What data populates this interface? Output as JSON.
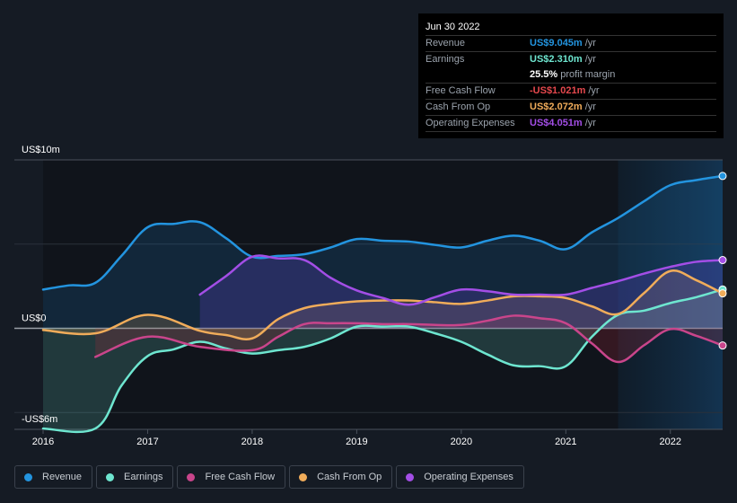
{
  "tooltip": {
    "date": "Jun 30 2022",
    "rows": [
      {
        "label": "Revenue",
        "value": "US$9.045m",
        "unit": "/yr",
        "color": "#2394df"
      },
      {
        "label": "Earnings",
        "value": "US$2.310m",
        "unit": "/yr",
        "color": "#6ee6d0"
      },
      {
        "label": "",
        "value": "25.5%",
        "unit": "profit margin",
        "color": "#ffffff"
      },
      {
        "label": "Free Cash Flow",
        "value": "-US$1.021m",
        "unit": "/yr",
        "color": "#e5484d"
      },
      {
        "label": "Cash From Op",
        "value": "US$2.072m",
        "unit": "/yr",
        "color": "#f0ac5a"
      },
      {
        "label": "Operating Expenses",
        "value": "US$4.051m",
        "unit": "/yr",
        "color": "#a34ee6"
      }
    ]
  },
  "legend": [
    {
      "label": "Revenue",
      "color": "#2394df"
    },
    {
      "label": "Earnings",
      "color": "#6ee6d0"
    },
    {
      "label": "Free Cash Flow",
      "color": "#c9458b"
    },
    {
      "label": "Cash From Op",
      "color": "#f0ac5a"
    },
    {
      "label": "Operating Expenses",
      "color": "#a34ee6"
    }
  ],
  "chart_data": {
    "type": "line",
    "title": "",
    "xlabel": "",
    "ylabel": "",
    "ylim": [
      -6,
      10
    ],
    "xlim": [
      2015.72,
      2022.5
    ],
    "y_tick_labels": [
      {
        "value": 10,
        "label": "US$10m"
      },
      {
        "value": 0,
        "label": "US$0"
      },
      {
        "value": -6,
        "label": "-US$6m"
      }
    ],
    "y_gridlines": [
      10,
      5,
      0,
      -5,
      -6
    ],
    "x_ticks": [
      2016,
      2017,
      2018,
      2019,
      2020,
      2021,
      2022
    ],
    "x_tick_labels": [
      "2016",
      "2017",
      "2018",
      "2019",
      "2020",
      "2021",
      "2022"
    ],
    "highlight_range": [
      2021.5,
      2022.5
    ],
    "grid": true,
    "legend_position": "bottom-left",
    "series": [
      {
        "name": "Revenue",
        "color": "#2394df",
        "fill": true,
        "x": [
          2016.0,
          2016.25,
          2016.5,
          2016.75,
          2017.0,
          2017.25,
          2017.5,
          2017.75,
          2018.0,
          2018.25,
          2018.5,
          2018.75,
          2019.0,
          2019.25,
          2019.5,
          2019.75,
          2020.0,
          2020.25,
          2020.5,
          2020.75,
          2021.0,
          2021.25,
          2021.5,
          2021.75,
          2022.0,
          2022.25,
          2022.5
        ],
        "values": [
          2.3,
          2.55,
          2.7,
          4.3,
          6.0,
          6.2,
          6.3,
          5.35,
          4.25,
          4.3,
          4.4,
          4.8,
          5.3,
          5.2,
          5.15,
          4.95,
          4.8,
          5.2,
          5.5,
          5.2,
          4.7,
          5.7,
          6.55,
          7.55,
          8.5,
          8.8,
          9.045
        ]
      },
      {
        "name": "Earnings",
        "color": "#6ee6d0",
        "fill": true,
        "x": [
          2016.0,
          2016.5,
          2016.75,
          2017.0,
          2017.25,
          2017.5,
          2017.75,
          2018.0,
          2018.25,
          2018.5,
          2018.75,
          2019.0,
          2019.25,
          2019.5,
          2019.75,
          2020.0,
          2020.25,
          2020.5,
          2020.75,
          2021.0,
          2021.25,
          2021.5,
          2021.75,
          2022.0,
          2022.25,
          2022.5
        ],
        "values": [
          -5.95,
          -5.95,
          -3.4,
          -1.65,
          -1.25,
          -0.8,
          -1.2,
          -1.5,
          -1.3,
          -1.1,
          -0.6,
          0.1,
          0.1,
          0.1,
          -0.3,
          -0.8,
          -1.55,
          -2.2,
          -2.25,
          -2.25,
          -0.5,
          0.8,
          1.05,
          1.5,
          1.85,
          2.31
        ]
      },
      {
        "name": "Free Cash Flow",
        "color": "#c9458b",
        "fill": true,
        "x": [
          2016.5,
          2017.0,
          2017.5,
          2018.0,
          2018.25,
          2018.5,
          2018.75,
          2019.0,
          2019.25,
          2019.5,
          2019.75,
          2020.0,
          2020.25,
          2020.5,
          2020.75,
          2021.0,
          2021.25,
          2021.5,
          2021.75,
          2022.0,
          2022.25,
          2022.5
        ],
        "values": [
          -1.7,
          -0.5,
          -1.1,
          -1.3,
          -0.5,
          0.25,
          0.3,
          0.3,
          0.25,
          0.25,
          0.2,
          0.2,
          0.45,
          0.75,
          0.6,
          0.3,
          -0.9,
          -2.0,
          -1.0,
          -0.05,
          -0.45,
          -1.021
        ]
      },
      {
        "name": "Cash From Op",
        "color": "#f0ac5a",
        "fill": true,
        "x": [
          2016.0,
          2016.5,
          2017.0,
          2017.5,
          2017.75,
          2018.0,
          2018.25,
          2018.5,
          2018.75,
          2019.0,
          2019.25,
          2019.5,
          2019.75,
          2020.0,
          2020.25,
          2020.5,
          2020.75,
          2021.0,
          2021.25,
          2021.5,
          2021.75,
          2022.0,
          2022.25,
          2022.5
        ],
        "values": [
          -0.1,
          -0.3,
          0.8,
          -0.15,
          -0.4,
          -0.6,
          0.55,
          1.2,
          1.45,
          1.6,
          1.65,
          1.65,
          1.55,
          1.45,
          1.65,
          1.9,
          1.9,
          1.8,
          1.3,
          0.85,
          2.1,
          3.4,
          2.85,
          2.072
        ]
      },
      {
        "name": "Operating Expenses",
        "color": "#a34ee6",
        "fill": true,
        "x": [
          2017.5,
          2017.75,
          2018.0,
          2018.25,
          2018.5,
          2018.75,
          2019.0,
          2019.25,
          2019.5,
          2019.75,
          2020.0,
          2020.25,
          2020.5,
          2020.75,
          2021.0,
          2021.25,
          2021.5,
          2021.75,
          2022.0,
          2022.25,
          2022.5
        ],
        "values": [
          2.0,
          3.1,
          4.25,
          4.15,
          4.05,
          3.0,
          2.25,
          1.8,
          1.4,
          1.85,
          2.3,
          2.2,
          2.0,
          2.0,
          2.0,
          2.4,
          2.8,
          3.25,
          3.65,
          3.95,
          4.051
        ]
      }
    ]
  }
}
